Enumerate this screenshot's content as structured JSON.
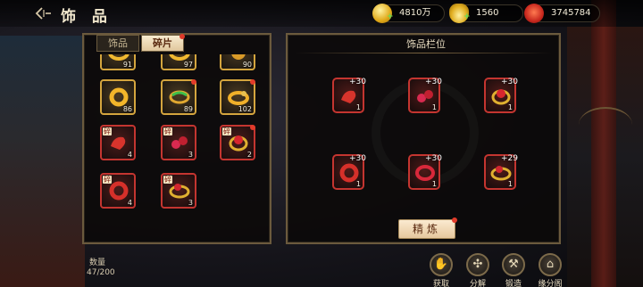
{
  "header": {
    "back_icon": "back-arrow-icon",
    "title": "饰 品"
  },
  "currency": {
    "gold": "4810万",
    "ingot": "1560",
    "power": "3745784"
  },
  "tabs": [
    {
      "label": "饰品",
      "active": false
    },
    {
      "label": "碎片",
      "active": true,
      "badge": true
    }
  ],
  "fragments": [
    {
      "count": "91",
      "border": "gold",
      "dot": false,
      "frag": false
    },
    {
      "count": "97",
      "border": "gold",
      "dot": true,
      "frag": false
    },
    {
      "count": "90",
      "border": "gold",
      "dot": true,
      "frag": false
    },
    {
      "count": "86",
      "border": "gold",
      "dot": false,
      "frag": false
    },
    {
      "count": "89",
      "border": "gold",
      "dot": true,
      "frag": false
    },
    {
      "count": "102",
      "border": "gold",
      "dot": true,
      "frag": false
    },
    {
      "count": "4",
      "border": "red",
      "dot": false,
      "frag": true
    },
    {
      "count": "3",
      "border": "red",
      "dot": false,
      "frag": true
    },
    {
      "count": "2",
      "border": "red",
      "dot": true,
      "frag": true
    },
    {
      "count": "4",
      "border": "red",
      "dot": false,
      "frag": true
    },
    {
      "count": "3",
      "border": "red",
      "dot": false,
      "frag": true
    }
  ],
  "fragment_tag": "碎",
  "slots": {
    "title": "饰品栏位",
    "items": [
      {
        "plus": "+30",
        "level": "1"
      },
      {
        "plus": "+30",
        "level": "1"
      },
      {
        "plus": "+30",
        "level": "1"
      },
      {
        "plus": "+30",
        "level": "1"
      },
      {
        "plus": "+30",
        "level": "1"
      },
      {
        "plus": "+29",
        "level": "1"
      }
    ]
  },
  "refine_label": "精炼",
  "quantity": {
    "label": "数量",
    "value": "47/200"
  },
  "actions": [
    {
      "label": "获取",
      "icon": "acquire-icon"
    },
    {
      "label": "分解",
      "icon": "decompose-icon"
    },
    {
      "label": "锻造",
      "icon": "forge-hammer-icon"
    },
    {
      "label": "缘分阁",
      "icon": "pavilion-icon"
    }
  ],
  "colors": {
    "gold_border": "#d4a53e",
    "red_border": "#c43530",
    "tab_active": "#f2e3c0",
    "badge": "#e23b2a"
  }
}
